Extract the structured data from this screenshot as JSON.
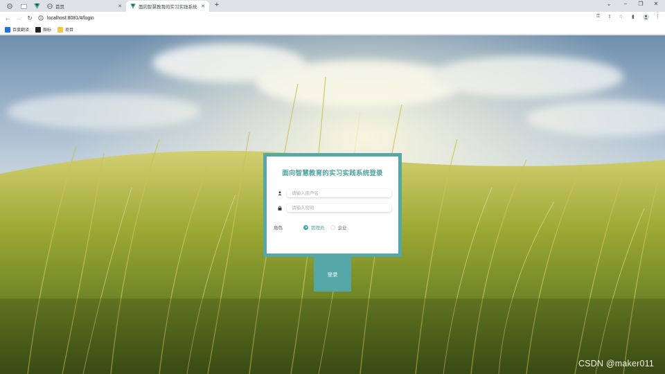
{
  "browser": {
    "tabs": [
      {
        "title": "首页",
        "icon": "globe-icon",
        "active": false
      },
      {
        "title": "面向智慧教育的实习实践系统",
        "icon": "vue-logo-icon",
        "active": true
      }
    ],
    "new_tab_symbol": "+",
    "address": {
      "url": "localhost:8081/#/login"
    },
    "bookmarks": [
      {
        "label": "百度翻译",
        "color": "#1a73e8"
      },
      {
        "label": "图标",
        "color": "#202124"
      },
      {
        "label": "项目",
        "color": "#f4c542"
      }
    ]
  },
  "login": {
    "title": "面向智慧教育的实习实践系统登录",
    "username_placeholder": "请输入用户名",
    "password_placeholder": "请输入密码",
    "role_label": "角色",
    "roles": [
      {
        "label": "管理员",
        "checked": true
      },
      {
        "label": "企业",
        "checked": false
      }
    ],
    "submit_label": "登录"
  },
  "watermark": "CSDN @maker011",
  "colors": {
    "accent": "#55a8a7",
    "title": "#4fa3a2"
  }
}
